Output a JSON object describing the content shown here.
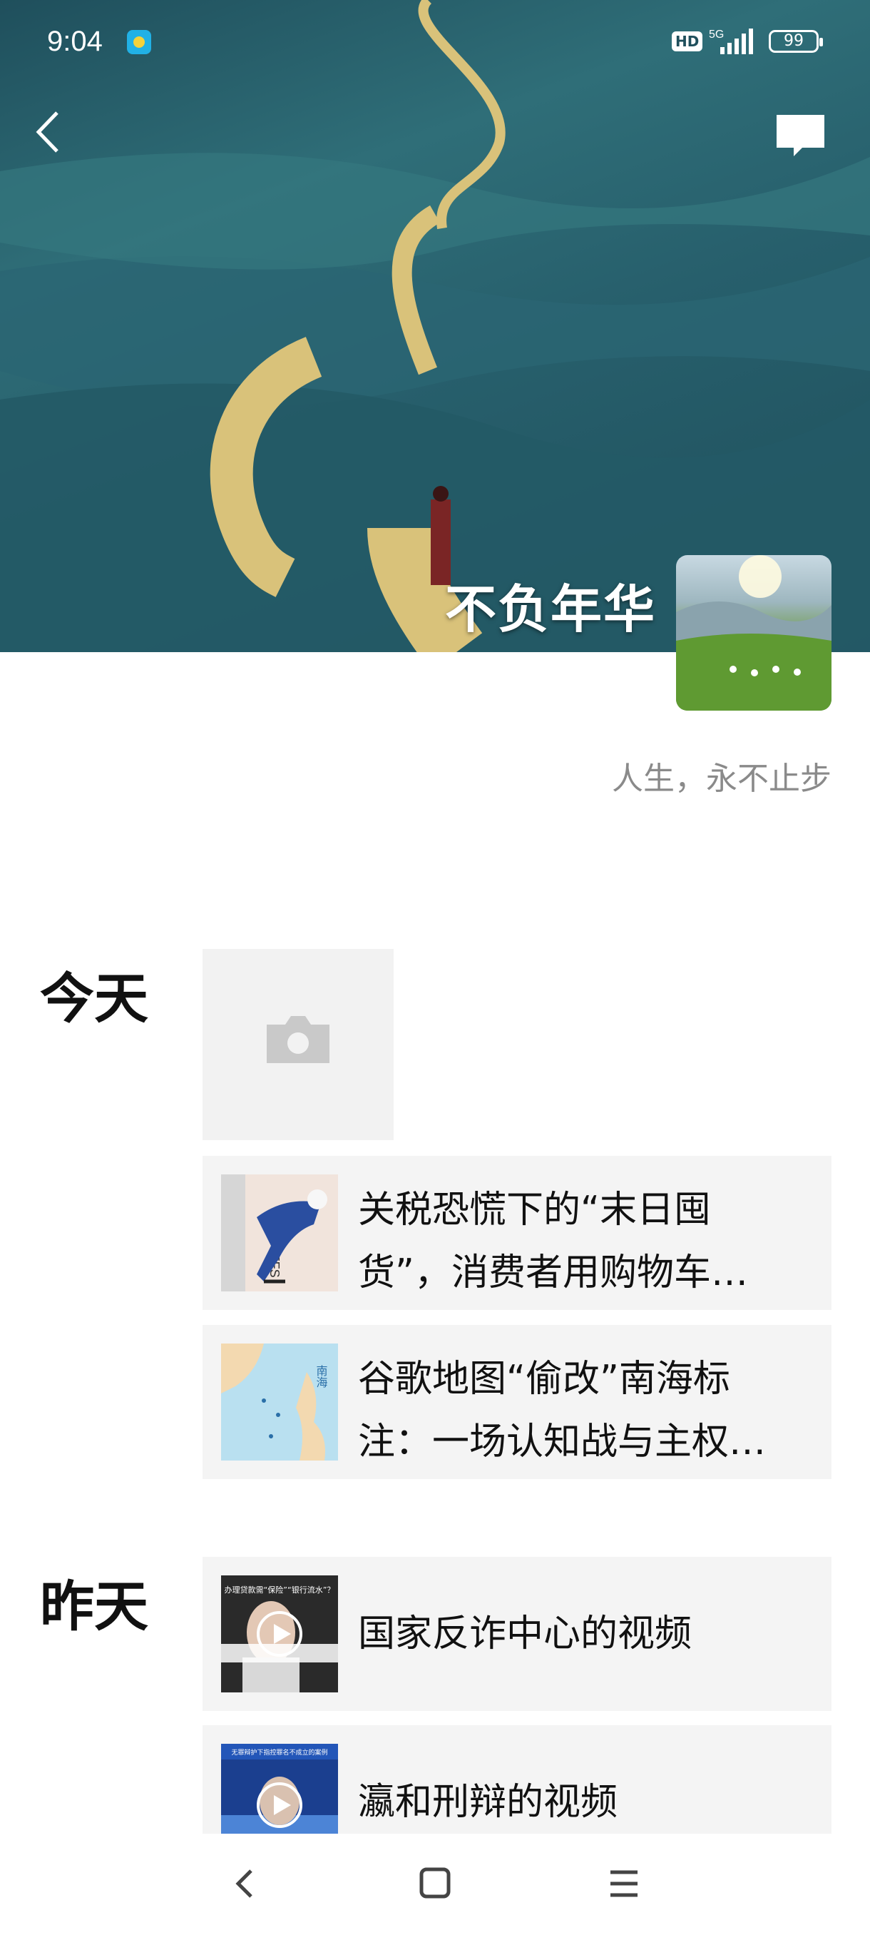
{
  "status_bar": {
    "time": "9:04",
    "hd_badge": "HD",
    "network": "5G",
    "battery": "99"
  },
  "profile": {
    "name": "不负年华",
    "signature": "人生，永不止步"
  },
  "timeline": {
    "today_label": "今天",
    "yesterday_label": "昨天",
    "today_posts": [
      {
        "title": "关税恐慌下的“末日囤货”，消费者用购物车…"
      },
      {
        "title": "谷歌地图“偷改”南海标注：一场认知战与主权…"
      }
    ],
    "yesterday_posts": [
      {
        "title": "国家反诈中心的视频",
        "thumb_caption": "办理贷款需“保险”“银行流水”？"
      },
      {
        "title": "瀛和刑辩的视频",
        "thumb_caption": "无罪辩护下指控罪名不成立的案例"
      }
    ],
    "thumb_text": {
      "tariffs": "TARIFFS",
      "map_label": "南海"
    }
  },
  "icons": {
    "back": "chevron-left-icon",
    "comment": "message-bubble-icon",
    "camera": "camera-icon",
    "play": "play-icon",
    "nav_back": "nav-back-icon",
    "nav_home": "nav-home-icon",
    "nav_menu": "nav-menu-icon"
  },
  "colors": {
    "cover_teal": "#2f6e78",
    "road_yellow": "#d9c27a",
    "card_bg": "#f4f4f4",
    "signature_gray": "#8a8a8a"
  }
}
